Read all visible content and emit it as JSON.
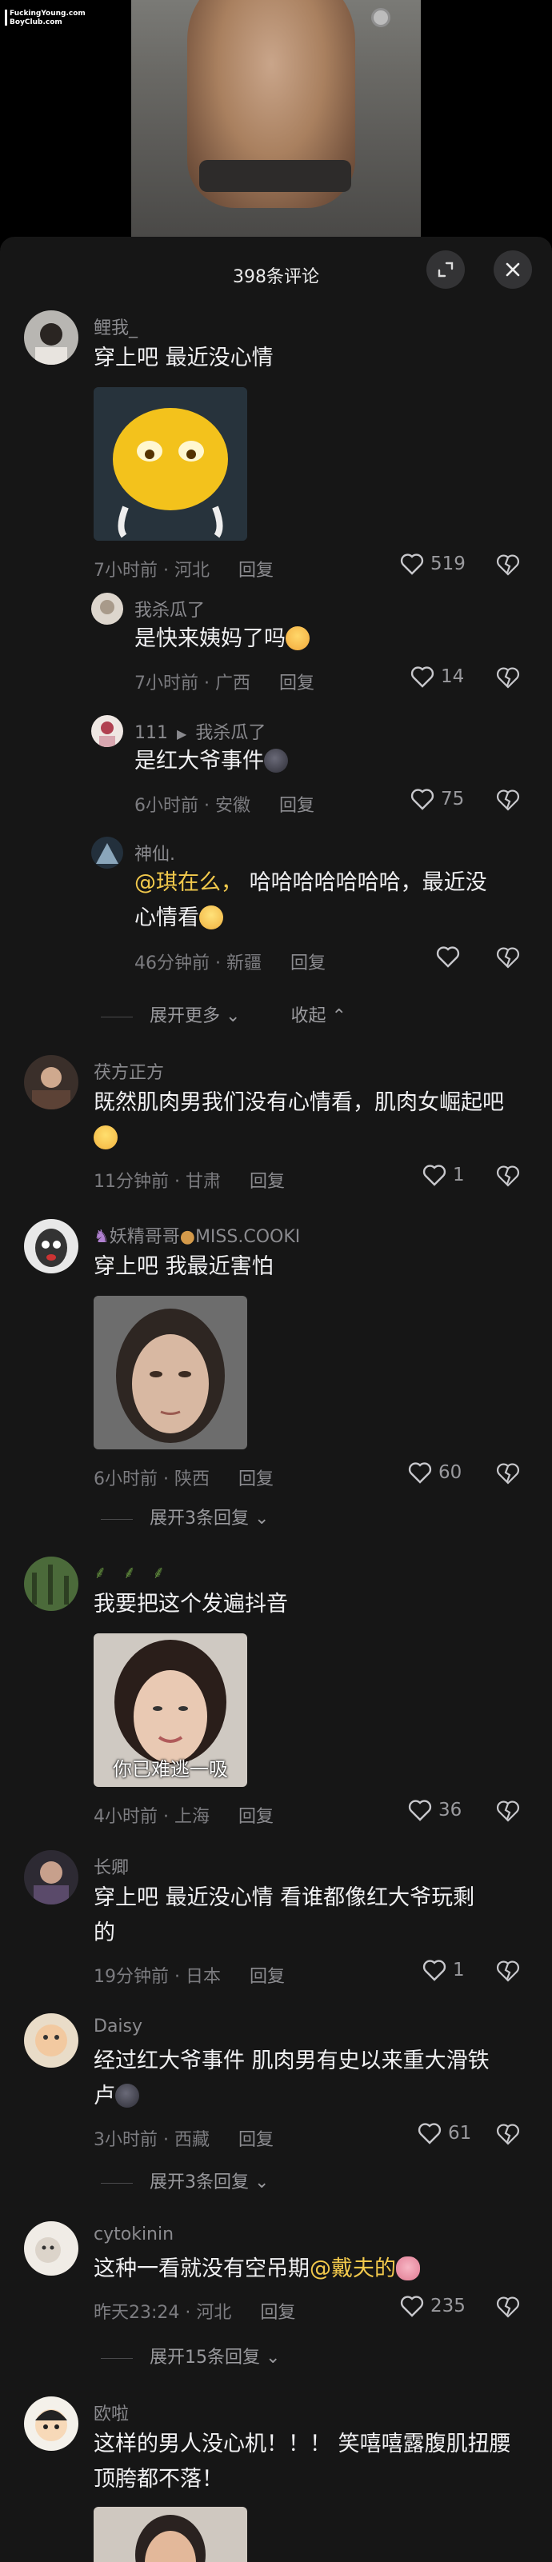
{
  "video": {
    "watermark": "FuckingYoung.com\nBoyClub.com",
    "watermark_line1": "FuckingYoung.com",
    "watermark_line2": "BoyClub.com"
  },
  "sheet": {
    "title": "398条评论",
    "expand_icon": "expand-icon",
    "close_icon": "close-icon"
  },
  "colors": {
    "sheet_bg": "#161616",
    "mention": "#f2c94c",
    "meta": "#7c7c80",
    "header_btn": "#333335"
  },
  "comments": [
    {
      "user": "鲤我_",
      "text": "穿上吧 最近没心情",
      "time_loc": "7小时前 · 河北",
      "reply": "回复",
      "likes": "519",
      "has_image": true
    },
    {
      "user": "我杀瓜了",
      "text": "是快来姨妈了吗",
      "time_loc": "7小时前 · 广西",
      "reply": "回复",
      "likes": "14"
    },
    {
      "user": "111",
      "reply_to": "我杀瓜了",
      "text": "是红大爷事件",
      "time_loc": "6小时前 · 安徽",
      "reply": "回复",
      "likes": "75"
    },
    {
      "user": "神仙.",
      "mention": "@琪在么，",
      "text": " 哈哈哈哈哈哈哈，最近没",
      "text2": "心情看",
      "time_loc": "46分钟前 · 新疆",
      "reply": "回复",
      "likes": ""
    },
    {
      "user": "茯方正方",
      "text": "既然肌肉男我们没有心情看，肌肉女崛起吧",
      "time_loc": "11分钟前 · 甘肃",
      "reply": "回复",
      "likes": "1"
    },
    {
      "user": "妖精哥哥",
      "user_suffix": "MISS.COOKI",
      "text": "穿上吧 我最近害怕",
      "time_loc": "6小时前 · 陕西",
      "reply": "回复",
      "likes": "60",
      "has_image": true
    },
    {
      "user": "",
      "text": "我要把这个发遍抖音",
      "time_loc": "4小时前 · 上海",
      "reply": "回复",
      "likes": "36",
      "has_image": true,
      "image_caption": "你已难逃一吸"
    },
    {
      "user": "长卿",
      "text": "穿上吧  最近没心情  看谁都像红大爷玩剩",
      "text2": "的",
      "time_loc": "19分钟前 · 日本",
      "reply": "回复",
      "likes": "1"
    },
    {
      "user": "Daisy",
      "text": "经过红大爷事件 肌肉男有史以来重大滑铁",
      "text2": "卢",
      "time_loc": "3小时前 · 西藏",
      "reply": "回复",
      "likes": "61"
    },
    {
      "user": "cytokinin",
      "text": "这种一看就没有空吊期",
      "mention": "@戴夫的",
      "time_loc": "昨天23:24 · 河北",
      "reply": "回复",
      "likes": "235"
    },
    {
      "user": "欧啦",
      "text": "这样的男人没心机！！！ 笑嘻嘻露腹肌扭腰",
      "text2": "顶胯都不落！"
    }
  ],
  "expanders": {
    "more": "展开更多",
    "collapse": "收起",
    "e1": "展开3条回复",
    "e2": "展开3条回复",
    "e3": "展开15条回复"
  }
}
